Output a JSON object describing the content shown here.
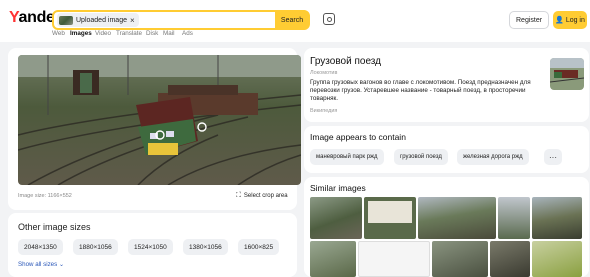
{
  "header": {
    "logo": "Yandex",
    "search_chip_label": "Uploaded image",
    "search_button": "Search",
    "register": "Register",
    "login": "Log in"
  },
  "nav": {
    "items": [
      "Web",
      "Images",
      "Video",
      "Translate",
      "Disk",
      "Mail",
      "Ads"
    ],
    "active": "Images"
  },
  "main_image": {
    "size_text": "Image size: 1166×552",
    "crop_button": "Select crop area"
  },
  "other_sizes": {
    "title": "Other image sizes",
    "sizes": [
      "2048×1350",
      "1880×1056",
      "1524×1050",
      "1380×1056",
      "1600×825"
    ],
    "show_all": "Show all sizes"
  },
  "info": {
    "title": "Грузовой поезд",
    "subtitle": "Локомотив",
    "description": "Группа грузовых вагонов во главе с локомотивом. Поезд предназначен для перевозки грузов. Устаревшее название - товарный поезд, в просторечии товарняк.",
    "source": "Википедия"
  },
  "contains": {
    "title": "Image appears to contain",
    "tags": [
      "маневровый парк ржд",
      "грузовой поезд",
      "железная дорога ржд"
    ],
    "more": "···"
  },
  "similar": {
    "title": "Similar images"
  },
  "colors": {
    "accent": "#ffcc33",
    "brand_red": "#ff3333",
    "link": "#2a57b8",
    "background": "#f2f3f5"
  }
}
